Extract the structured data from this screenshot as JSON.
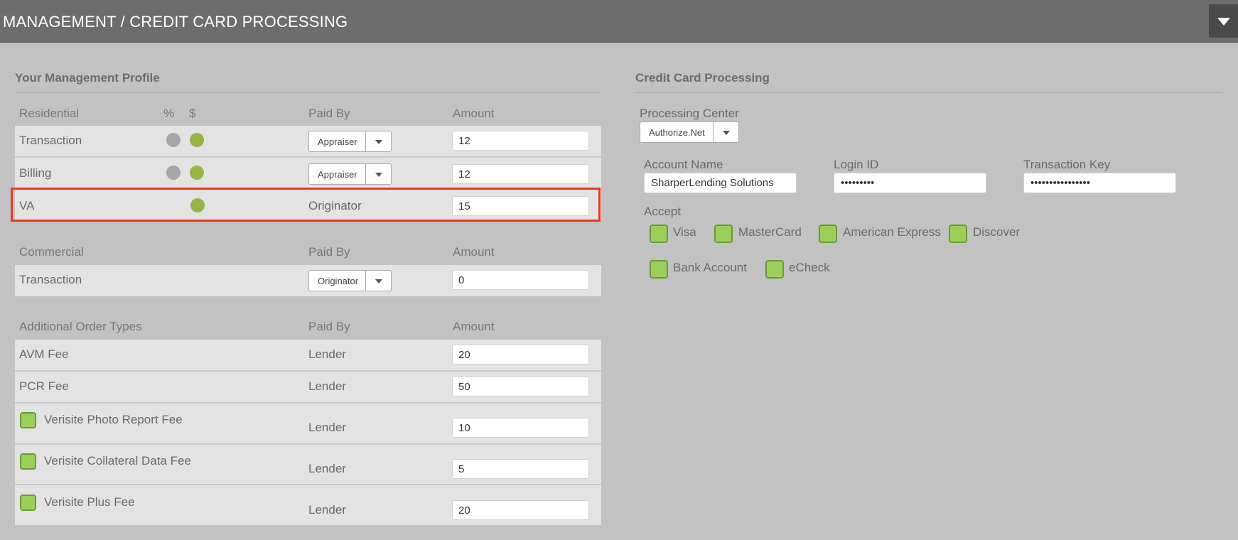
{
  "header": {
    "title": "MANAGEMENT / CREDIT CARD PROCESSING"
  },
  "management": {
    "section_title": "Your Management Profile",
    "residential": {
      "headers": {
        "type": "Residential",
        "percent": "%",
        "dollar": "$",
        "paid_by": "Paid By",
        "amount": "Amount"
      },
      "rows": [
        {
          "label": "Transaction",
          "paid_by": "Appraiser",
          "amount": "12"
        },
        {
          "label": "Billing",
          "paid_by": "Appraiser",
          "amount": "12"
        },
        {
          "label": "VA",
          "paid_by": "Originator",
          "amount": "15"
        }
      ]
    },
    "commercial": {
      "headers": {
        "type": "Commercial",
        "paid_by": "Paid By",
        "amount": "Amount"
      },
      "rows": [
        {
          "label": "Transaction",
          "paid_by": "Originator",
          "amount": "0"
        }
      ]
    },
    "additional": {
      "headers": {
        "type": "Additional Order Types",
        "paid_by": "Paid By",
        "amount": "Amount"
      },
      "rows": [
        {
          "label": "AVM Fee",
          "paid_by": "Lender",
          "amount": "20"
        },
        {
          "label": "PCR Fee",
          "paid_by": "Lender",
          "amount": "50"
        },
        {
          "label": "Verisite Photo Report Fee",
          "paid_by": "Lender",
          "amount": "10"
        },
        {
          "label": "Verisite Collateral Data Fee",
          "paid_by": "Lender",
          "amount": "5"
        },
        {
          "label": "Verisite Plus Fee",
          "paid_by": "Lender",
          "amount": "20"
        }
      ]
    }
  },
  "credit": {
    "section_title": "Credit Card Processing",
    "processing_center_label": "Processing Center",
    "processing_center_value": "Authorize.Net",
    "account_name_label": "Account Name",
    "account_name_value": "SharperLending Solutions",
    "login_id_label": "Login ID",
    "login_id_value": "•••••••••",
    "transaction_key_label": "Transaction Key",
    "transaction_key_value": "••••••••••••••••",
    "accept_label": "Accept",
    "accept_options": [
      "Visa",
      "MasterCard",
      "American Express",
      "Discover",
      "Bank Account",
      "eCheck"
    ]
  }
}
